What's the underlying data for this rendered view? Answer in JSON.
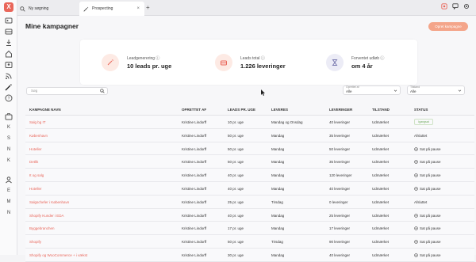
{
  "browser": {
    "tabs": [
      {
        "label": "Ny søgning"
      },
      {
        "label": "Prospecting"
      }
    ],
    "new_tab_symbol": "+",
    "close_symbol": "×"
  },
  "sidebar": {
    "logo_letter": "X",
    "letter_items": [
      "K",
      "S",
      "N",
      "K",
      "E",
      "M",
      "N"
    ]
  },
  "page": {
    "title": "Mine kampagner",
    "create_button": "Opret kampagne"
  },
  "stats": [
    {
      "label": "Leadgenerering",
      "value": "10 leads pr. uge",
      "color": "#fdeae4"
    },
    {
      "label": "Leads total",
      "value": "1.226 leveringer",
      "color": "#fdeae4"
    },
    {
      "label": "Forventet udløb",
      "value": "om 4 år",
      "color": "#ececf6"
    }
  ],
  "filters": {
    "search_placeholder": "Søg",
    "dropdown1": {
      "label": "Oprettet af",
      "value": "Alle"
    },
    "dropdown2": {
      "label": "Tilstand",
      "value": "Alle"
    }
  },
  "table": {
    "headers": [
      "KAMPAGNE NAVN",
      "OPRETTET AF",
      "LEADS PR. UGE",
      "LEVERES",
      "LEVERINGER",
      "TILSTAND",
      "STATUS"
    ],
    "rows": [
      {
        "name": "Salg bg IT",
        "by": "Kristine Lindorff",
        "leads": "10 pr. uge",
        "delivered": "Mandag og Onsdag",
        "count": "40 leveringer",
        "state": "Udmærket",
        "status": "Igangsat",
        "status_type": "logo"
      },
      {
        "name": "København",
        "by": "Kristine Lindorff",
        "leads": "50 pr. uge",
        "delivered": "Mandag",
        "count": "35 leveringer",
        "state": "Udmærket",
        "status": "Afsluttet",
        "status_type": "text"
      },
      {
        "name": "Hoteller",
        "by": "Kristine Lindorff",
        "leads": "50 pr. uge",
        "delivered": "Mandag",
        "count": "50 leveringer",
        "state": "Udmærket",
        "status": "Sat på pause",
        "status_type": "pause"
      },
      {
        "name": "Detlik",
        "by": "Kristine Lindorff",
        "leads": "50 pr. uge",
        "delivered": "Mandag",
        "count": "35 leveringer",
        "state": "Udmærket",
        "status": "Sat på pause",
        "status_type": "pause"
      },
      {
        "name": "It og salg",
        "by": "Kristine Lindorff",
        "leads": "40 pr. uge",
        "delivered": "Mandag",
        "count": "120 leveringer",
        "state": "Udmærket",
        "status": "Sat på pause",
        "status_type": "pause"
      },
      {
        "name": "Hoteller",
        "by": "Kristine Lindorff",
        "leads": "40 pr. uge",
        "delivered": "Mandag",
        "count": "40 leveringer",
        "state": "Udmærket",
        "status": "Sat på pause",
        "status_type": "pause"
      },
      {
        "name": "Salgschefer i København",
        "by": "Kristine Lindorff",
        "leads": "25 pr. uge",
        "delivered": "Tirsdag",
        "count": "0 leveringer",
        "state": "Udmærket",
        "status": "Afsluttet",
        "status_type": "text"
      },
      {
        "name": "Shopify Kunder i EDA",
        "by": "Kristine Lindorff",
        "leads": "40 pr. uge",
        "delivered": "Mandag",
        "count": "25 leveringer",
        "state": "Udmærket",
        "status": "Sat på pause",
        "status_type": "pause"
      },
      {
        "name": "Byggebranchen",
        "by": "Kristine Lindorff",
        "leads": "17 pr. uge",
        "delivered": "Mandag",
        "count": "17 leveringer",
        "state": "Udmærket",
        "status": "Sat på pause",
        "status_type": "pause"
      },
      {
        "name": "Shopify",
        "by": "Kristine Lindorff",
        "leads": "50 pr. uge",
        "delivered": "Tirsdag",
        "count": "90 leveringer",
        "state": "Udmærket",
        "status": "Sat på pause",
        "status_type": "pause"
      },
      {
        "name": "Shopify og WooCommerce + i vækst",
        "by": "Kristine Lindorff",
        "leads": "30 pr. uge",
        "delivered": "Mandag",
        "count": "40 leveringer",
        "state": "Udmærket",
        "status": "Sat på pause",
        "status_type": "pause"
      }
    ]
  }
}
